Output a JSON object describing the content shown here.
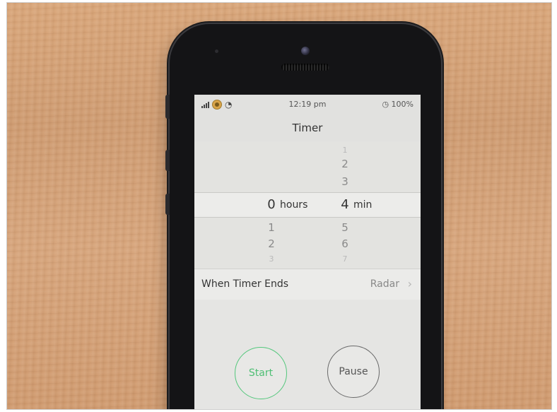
{
  "status_bar": {
    "time": "12:19 pm",
    "battery": "100%",
    "alarm_icon": "alarm-icon"
  },
  "nav": {
    "title": "Timer"
  },
  "picker": {
    "hours": {
      "above": [],
      "selected": "0",
      "below": [
        "1",
        "2",
        "3"
      ],
      "unit": "hours"
    },
    "minutes": {
      "above": [
        "1",
        "2",
        "3"
      ],
      "selected": "4",
      "below": [
        "5",
        "6",
        "7"
      ],
      "unit": "min"
    }
  },
  "when_timer_ends": {
    "label": "When Timer Ends",
    "value": "Radar"
  },
  "buttons": {
    "start": "Start",
    "pause": "Pause"
  },
  "colors": {
    "start_accent": "#4ebf74",
    "background_wood": "#d4a177",
    "phone_body": "#141416"
  }
}
